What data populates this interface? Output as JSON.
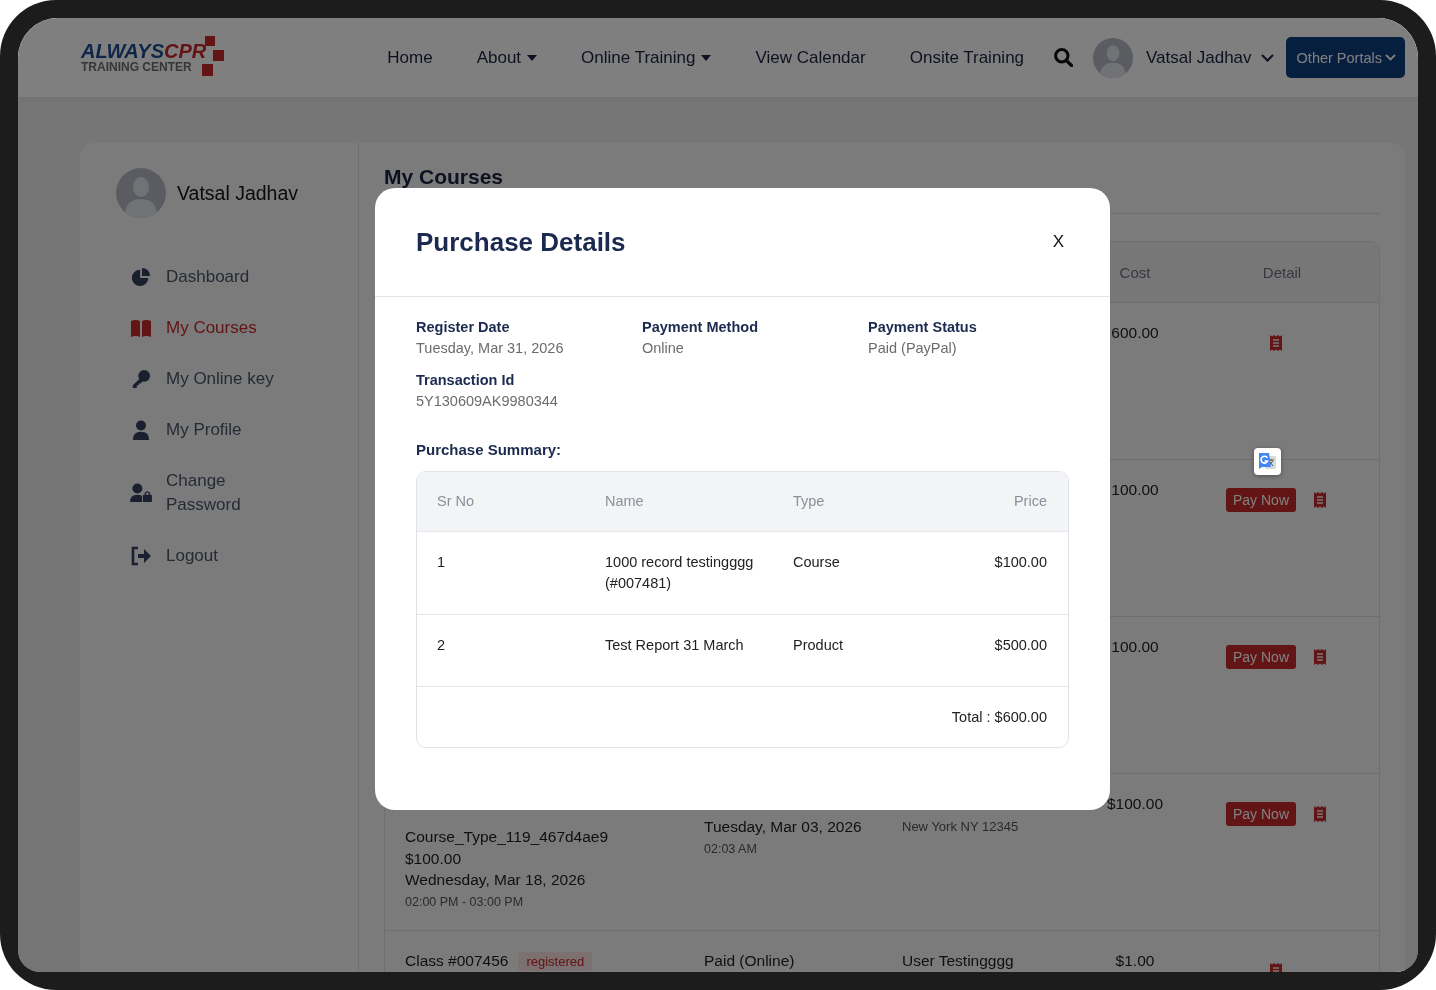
{
  "header": {
    "logo": {
      "name_part_1": "ALWAYS",
      "name_part_2": "CPR",
      "tagline": "TRAINING CENTER"
    },
    "nav": [
      {
        "label": "Home",
        "dropdown": false
      },
      {
        "label": "About",
        "dropdown": true
      },
      {
        "label": "Online Training",
        "dropdown": true
      },
      {
        "label": "View Calendar",
        "dropdown": false
      },
      {
        "label": "Onsite Training",
        "dropdown": false
      }
    ],
    "user_menu": {
      "name": "Vatsal Jadhav"
    },
    "portals_button": {
      "label": "Other Portals"
    }
  },
  "sidebar": {
    "user_name": "Vatsal Jadhav",
    "items": [
      {
        "label": "Dashboard",
        "selected": false
      },
      {
        "label": "My Courses",
        "selected": true
      },
      {
        "label": "My Online key",
        "selected": false
      },
      {
        "label": "My Profile",
        "selected": false
      },
      {
        "label": "Change Password",
        "selected": false
      },
      {
        "label": "Logout",
        "selected": false
      }
    ]
  },
  "courses": {
    "title": "My Courses",
    "table": {
      "columns": [
        "Cost",
        "Detail"
      ],
      "rows": [
        {
          "cost": "600.00"
        },
        {
          "cost": "100.00",
          "pay_button": "Pay Now"
        },
        {
          "cost": "100.00",
          "pay_button": "Pay Now"
        },
        {
          "course_name": "Course_Type_119_467d4ae9",
          "course_price": "$100.00",
          "course_date": "Wednesday, Mar 18, 2026",
          "course_time": "02:00 PM - 03:00 PM",
          "payment_date": "Tuesday, Mar 03, 2026",
          "payment_time": "02:03 AM",
          "address": "New York NY 12345",
          "cost": "$100.00",
          "pay_button": "Pay Now"
        },
        {
          "class_name": "Class #007456",
          "status_badge": "registered",
          "payment_status": "Paid (Online)",
          "user_name": "User Testingggg",
          "cost": "$1.00"
        }
      ]
    }
  },
  "modal": {
    "title": "Purchase Details",
    "close_label": "X",
    "fields": [
      {
        "label": "Register Date",
        "value": "Tuesday, Mar 31, 2026"
      },
      {
        "label": "Payment Method",
        "value": "Online"
      },
      {
        "label": "Payment Status",
        "value": "Paid (PayPal)"
      },
      {
        "label": "Transaction Id",
        "value": "5Y130609AK9980344"
      }
    ],
    "summary_title": "Purchase Summary:",
    "summary_table": {
      "columns": [
        "Sr No",
        "Name",
        "Type",
        "Price"
      ],
      "rows": [
        {
          "sr_no": "1",
          "name": "1000 record testingggg (#007481)",
          "type": "Course",
          "price": "$100.00"
        },
        {
          "sr_no": "2",
          "name": "Test Report 31 March",
          "type": "Product",
          "price": "$500.00"
        }
      ],
      "total": "Total : $600.00"
    }
  }
}
